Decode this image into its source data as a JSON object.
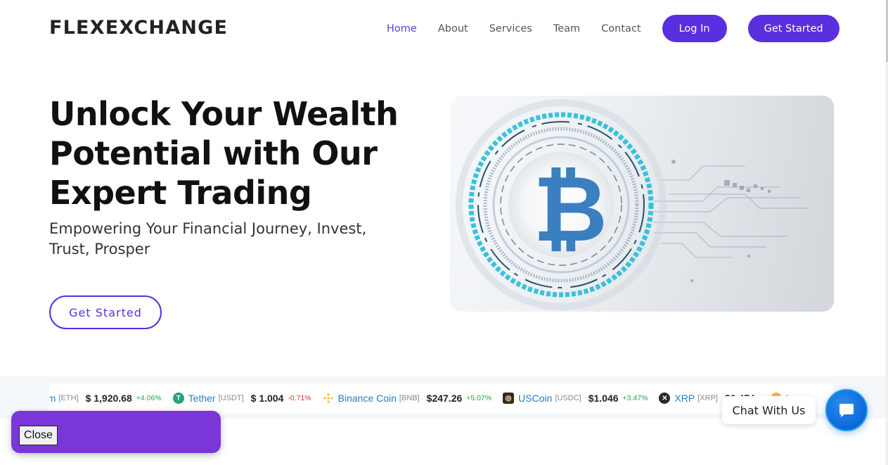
{
  "brand": {
    "logo": "FLEXEXCHANGE"
  },
  "nav": {
    "links": [
      {
        "label": "Home",
        "active": true
      },
      {
        "label": "About",
        "active": false
      },
      {
        "label": "Services",
        "active": false
      },
      {
        "label": "Team",
        "active": false
      },
      {
        "label": "Contact",
        "active": false
      }
    ],
    "login_label": "Log In",
    "get_started_label": "Get Started"
  },
  "hero": {
    "title": "Unlock Your Wealth Potential with Our Expert Trading",
    "subtitle": "Empowering Your Financial Journey, Invest, Trust, Prosper",
    "cta_label": "Get Started",
    "image_icon": "bitcoin-icon"
  },
  "ticker": {
    "items": [
      {
        "name": "um",
        "symbol": "[ETH]",
        "price": "$ 1,920.68",
        "change": "+4.06%",
        "direction": "up",
        "icon": "ethereum-icon",
        "icon_color": "#627eea"
      },
      {
        "name": "Tether",
        "symbol": "[USDT]",
        "price": "$ 1.004",
        "change": "-0.71%",
        "direction": "down",
        "icon": "tether-icon",
        "icon_color": "#26a17b"
      },
      {
        "name": "Binance Coin",
        "symbol": "[BNB]",
        "price": "$247.26",
        "change": "+5.07%",
        "direction": "up",
        "icon": "binance-icon",
        "icon_color": "#f3ba2f"
      },
      {
        "name": "USCoin",
        "symbol": "[USDC]",
        "price": "$1.046",
        "change": "+3.47%",
        "direction": "up",
        "icon": "uscoin-icon",
        "icon_color": "#3a2a10"
      },
      {
        "name": "XRP",
        "symbol": "[XRP]",
        "price": "$0.474",
        "change": "",
        "direction": "up",
        "icon": "xrp-icon",
        "icon_color": "#23292f"
      },
      {
        "name": "Lum",
        "symbol": "",
        "price": "",
        "change": "",
        "direction": "up",
        "icon": "lumen-icon",
        "icon_color": "#f3ba2f"
      }
    ]
  },
  "chat": {
    "label": "Chat With Us",
    "icon": "chat-bubble-icon",
    "accent": "#0a6ad8"
  },
  "promo": {
    "close_label": "Close",
    "background": "#7a36d6"
  },
  "colors": {
    "primary": "#5a2fe0",
    "up": "#22a64a",
    "down": "#e0302f"
  }
}
